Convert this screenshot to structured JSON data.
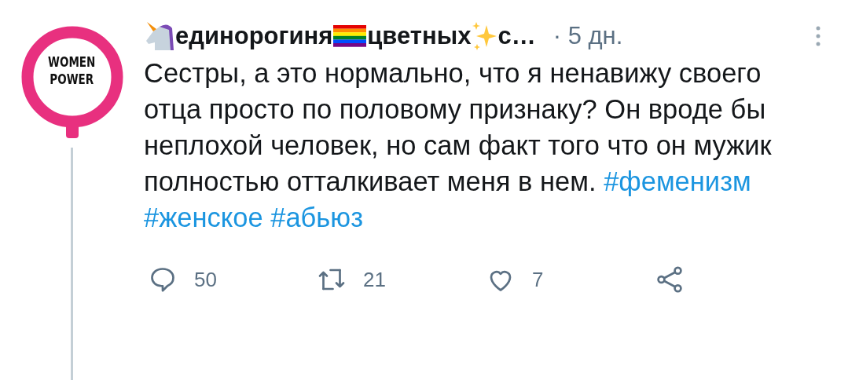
{
  "avatar": {
    "lines": [
      "WOMEN",
      "POWER"
    ]
  },
  "author": {
    "name_parts": [
      "единорогиня",
      "цветных",
      "с…"
    ],
    "time": "· 5 дн."
  },
  "tweet": {
    "text": "Сестры, а это нормально, что я ненавижу своего отца просто по половому признаку? Он вроде бы неплохой человек, но сам факт того что он мужик полностью отталкивает меня в нем.",
    "hashtags": [
      "#феменизм",
      "#женское",
      "#абьюз"
    ]
  },
  "actions": [
    {
      "kind": "reply",
      "count": "50"
    },
    {
      "kind": "retweet",
      "count": "21"
    },
    {
      "kind": "like",
      "count": "7"
    },
    {
      "kind": "share"
    }
  ]
}
